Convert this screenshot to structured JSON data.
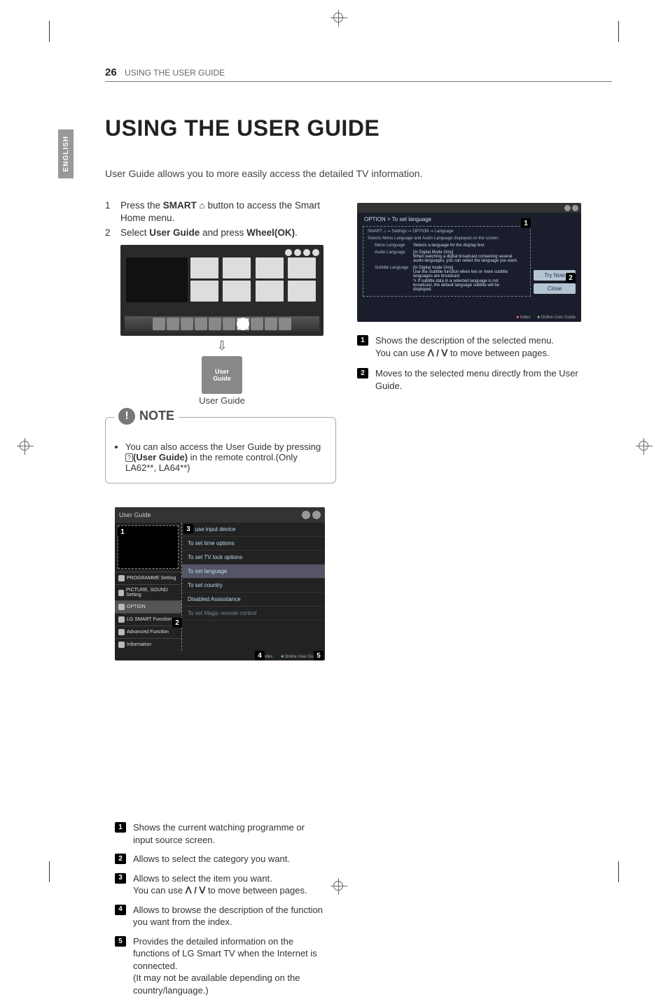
{
  "header": {
    "page_number": "26",
    "running_head": "USING THE USER GUIDE"
  },
  "language_tab": "ENGLISH",
  "title": "USING THE USER GUIDE",
  "intro": "User Guide allows you to more easily access the detailed TV information.",
  "steps": {
    "s1_num": "1",
    "s1_a": "Press the ",
    "s1_bold": "SMART ",
    "s1_b": " button to access the Smart Home menu.",
    "s2_num": "2",
    "s2_a": "Select ",
    "s2_b1": "User Guide",
    "s2_mid": " and press ",
    "s2_b2": "Wheel(OK)",
    "s2_end": "."
  },
  "user_guide_tile": {
    "line1": "User",
    "line2": "Guide",
    "caption": "User Guide"
  },
  "note": {
    "label": "NOTE",
    "text_a": "You can also access the User Guide by pressing ",
    "text_bold": "(User Guide)",
    "text_b": " in the remote control.(Only LA62**, LA64**)"
  },
  "ug_window": {
    "title": "User Guide",
    "categories": {
      "c1": "PROGRAMME Setting",
      "c2": "PICTURE, SOUND Setting",
      "c3": "OPTION",
      "c4": "LG SMART Function",
      "c5": "Advanced Function",
      "c6": "Information"
    },
    "items": {
      "i1": "To use input device",
      "i2": "To set time options",
      "i3": "To set TV lock options",
      "i4": "To set language",
      "i5": "To set country",
      "i6": "Disabled Assisstance",
      "i7": "To set Magic remote control"
    },
    "footer": {
      "index": "Index",
      "online": "Online User Guide"
    }
  },
  "left_legend": {
    "l1": "Shows the current watching programme or input source screen.",
    "l2": "Allows to select the category you want.",
    "l3a": "Allows to select the item you want.",
    "l3b": "You can use ",
    "l3c": " to move between pages.",
    "l4": "Allows to browse the description of the function you want from the index.",
    "l5": "Provides the detailed information on the functions of LG Smart TV when the Internet is connected.\n(It may not be available depending on the country/language.)"
  },
  "detail_window": {
    "crumb": "OPTION > To set language",
    "path": "SMART ⌂ ➙ Settings ➙ OPTION ➙ Language",
    "caption": "Selects Menu Language and Audio Language displayed on the screen.",
    "rows": {
      "r1k": "Menu Language",
      "r1v": "Selects a language for the display text.",
      "r2k": "Audio Language",
      "r2v_a": "[In Digital Mode Only]",
      "r2v_b": "When watching a digital broadcast containing several audio languages, you can select the language you want.",
      "r3k": "Subtitle Language",
      "r3v_a": "[In Digital mode Only]",
      "r3v_b": "Use the Subtitle function when two or more subtitle languages are broadcast.",
      "r3v_c": "✎ If subtitle data in a selected language is not broadcast, the default language subtitle will be displayed."
    },
    "try_now": "Try Now",
    "close": "Close",
    "footer": {
      "index": "Index",
      "online": "Online User Guide"
    }
  },
  "right_legend": {
    "l1a": "Shows the description of the selected menu.",
    "l1b": "You can use ",
    "l1c": " to move between pages.",
    "l2": "Moves to the selected menu directly from the User Guide."
  },
  "badges": {
    "b1": "1",
    "b2": "2",
    "b3": "3",
    "b4": "4",
    "b5": "5"
  },
  "updown_symbol": "ꓥ / ꓦ"
}
